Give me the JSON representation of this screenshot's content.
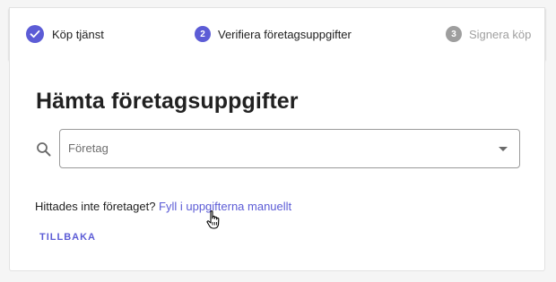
{
  "stepper": {
    "steps": [
      {
        "number": "",
        "label": "Köp tjänst",
        "status": "done",
        "icon": "check-icon"
      },
      {
        "number": "2",
        "label": "Verifiera företagsuppgifter",
        "status": "active"
      },
      {
        "number": "3",
        "label": "Signera köp",
        "status": "inactive"
      }
    ]
  },
  "main": {
    "title": "Hämta företagsuppgifter",
    "search_icon": "search-icon",
    "company_select": {
      "placeholder": "Företag",
      "icon": "chevron-down-icon"
    },
    "not_found_text": "Hittades inte företaget? ",
    "manual_link": "Fyll i uppgifterna manuellt",
    "back_button": "TILLBAKA"
  },
  "colors": {
    "accent": "#5c5cd6",
    "inactive": "#9e9e9e",
    "text": "#212121"
  }
}
